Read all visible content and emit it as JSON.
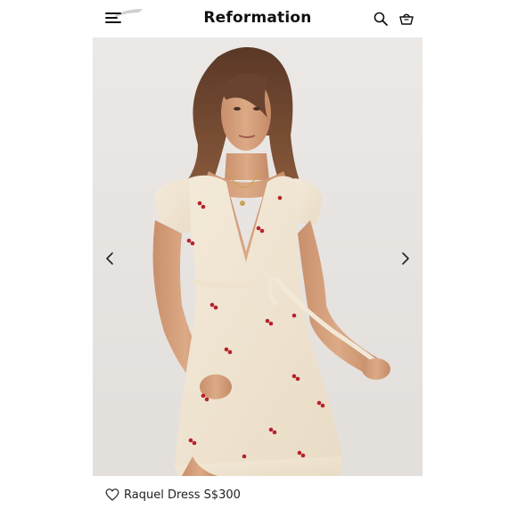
{
  "header": {
    "brand": "Reformation",
    "icons": {
      "menu": "menu-icon",
      "search": "search-icon",
      "bag": "shopping-bag-icon"
    }
  },
  "gallery": {
    "image": "woman-in-cream-cherry-print-wrap-dress",
    "prev_icon": "chevron-left-icon",
    "next_icon": "chevron-right-icon"
  },
  "product": {
    "name": "Raquel Dress",
    "price": "S$300",
    "wishlist_icon": "heart-outline-icon"
  },
  "colors": {
    "background": "#ffffff",
    "photo_backdrop": "#e8e5e2",
    "dress": "#f1e6d3",
    "cherry": "#b5222a",
    "text": "#111111"
  }
}
